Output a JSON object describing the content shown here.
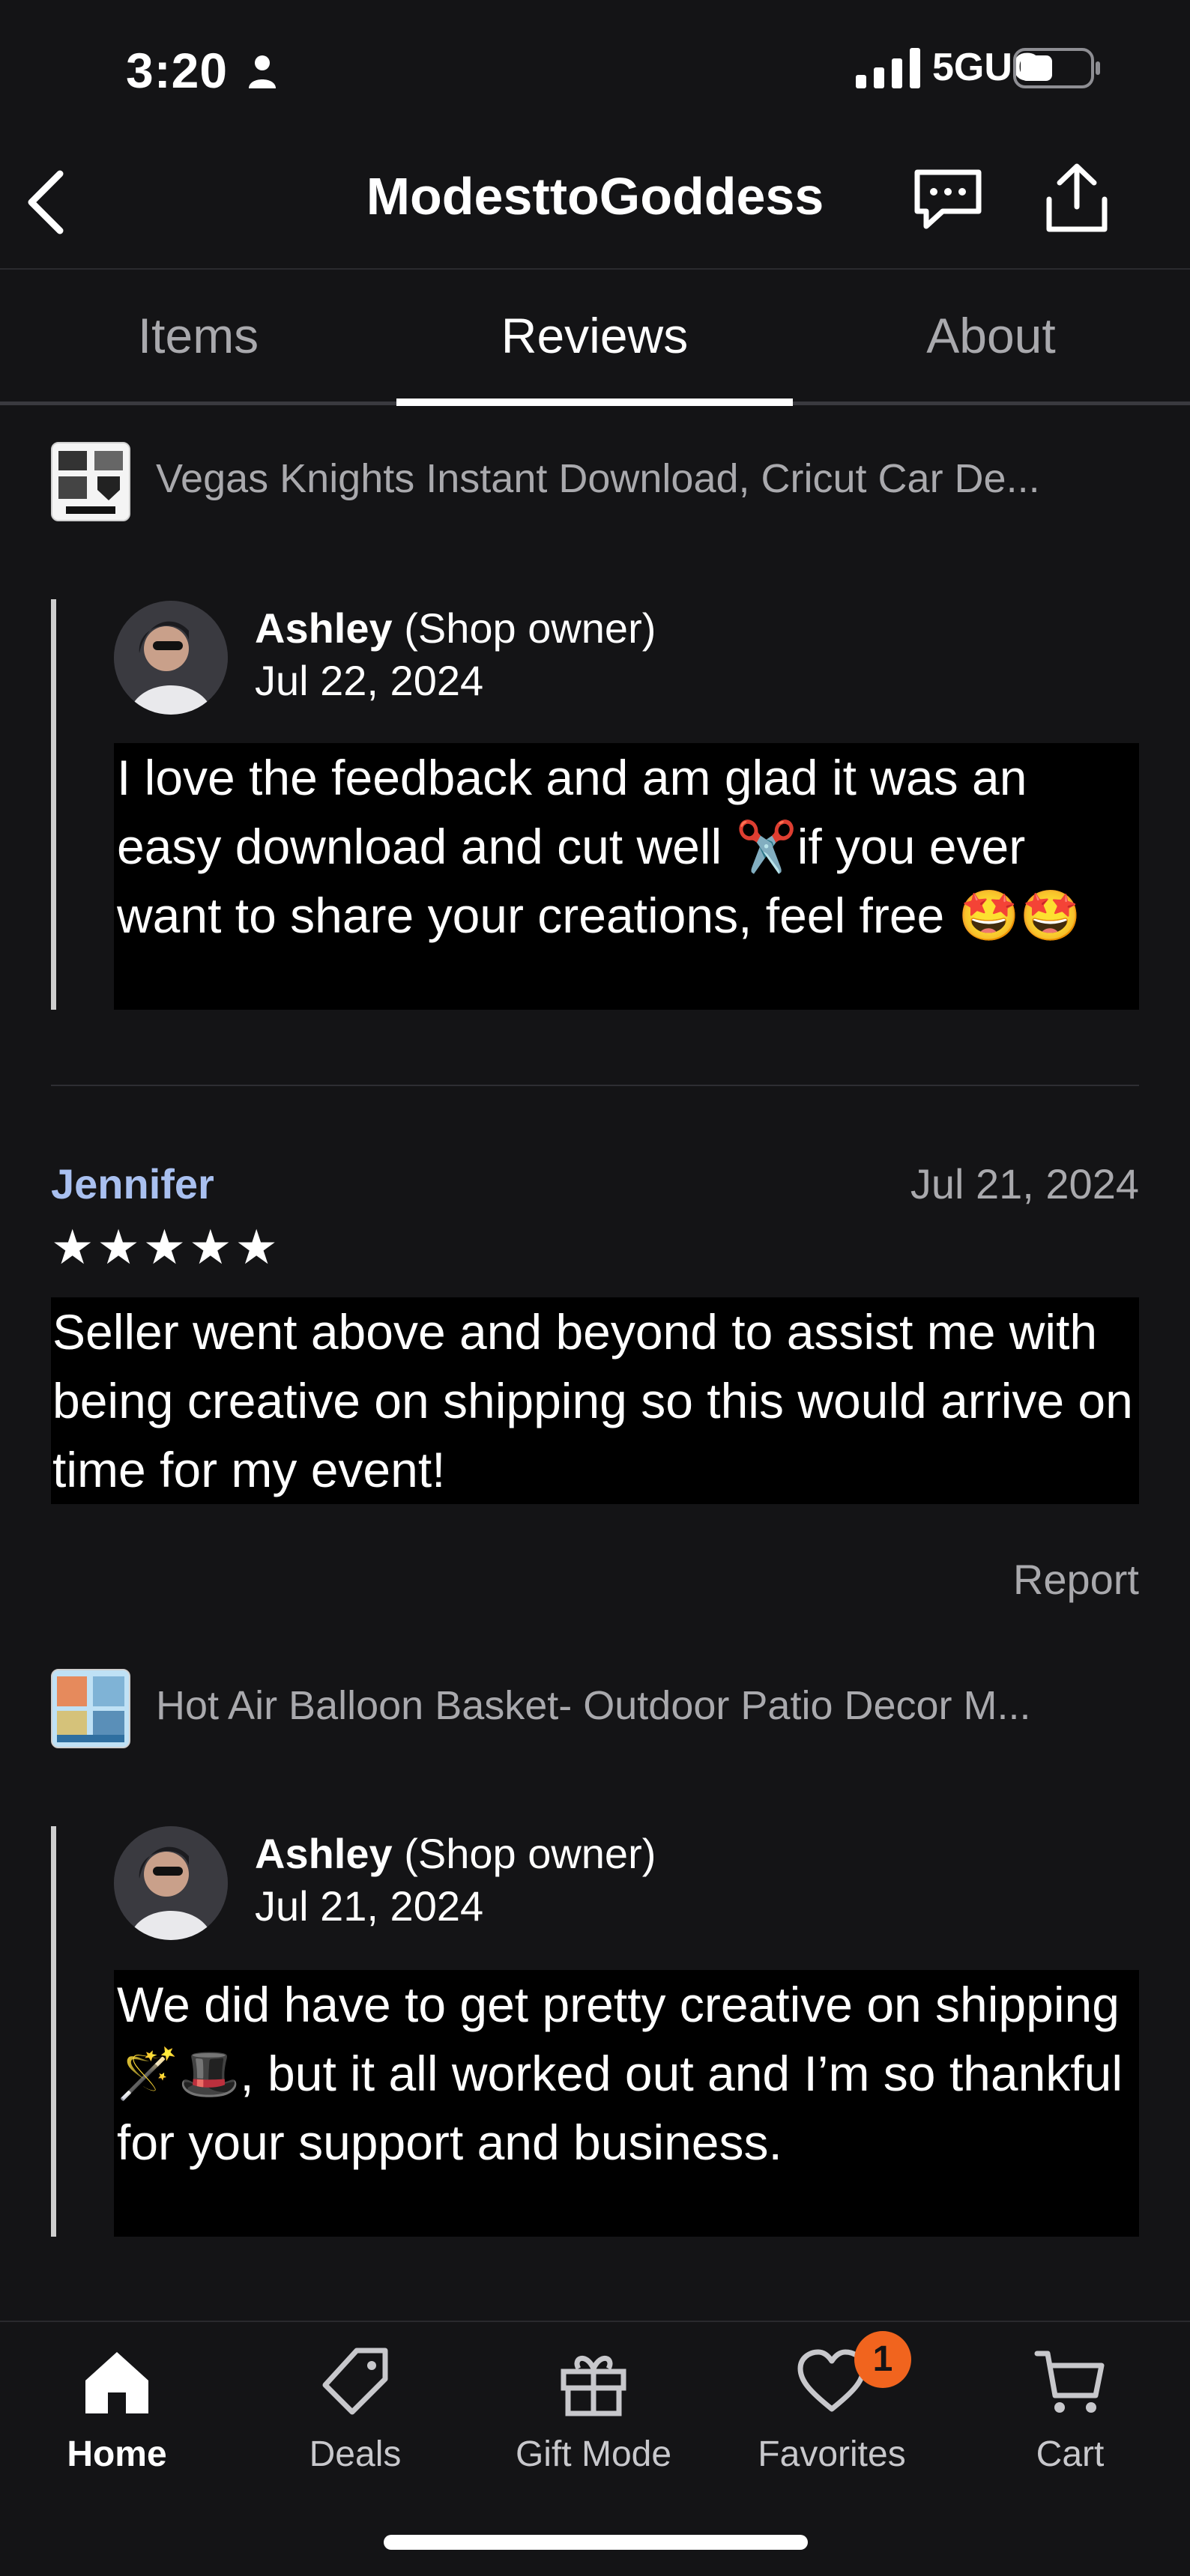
{
  "status_bar": {
    "time": "3:20",
    "network": "5GUC"
  },
  "header": {
    "title": "ModesttoGoddess"
  },
  "tabs": [
    {
      "label": "Items",
      "active": false
    },
    {
      "label": "Reviews",
      "active": true
    },
    {
      "label": "About",
      "active": false
    }
  ],
  "listing1": {
    "title": "Vegas Knights Instant Download, Cricut Car De..."
  },
  "reply1": {
    "name": "Ashley",
    "role": "(Shop owner)",
    "date": "Jul 22, 2024",
    "text": "I love the feedback and am glad it was an easy download and cut well ✂️if you ever want to share your creations, feel free 🤩🤩"
  },
  "review": {
    "reviewer": "Jennifer",
    "date": "Jul 21, 2024",
    "rating": 5,
    "stars": "★★★★★",
    "text": "Seller went above and beyond to assist me with being creative on shipping so this would arrive on time for my event!",
    "report_label": "Report"
  },
  "listing2": {
    "title": "Hot Air Balloon Basket- Outdoor Patio Decor M..."
  },
  "reply2": {
    "name": "Ashley",
    "role": "(Shop owner)",
    "date": "Jul 21, 2024",
    "text": "We did have to get pretty creative on shipping 🪄🎩, but it all worked out and I’m so thankful for your support and business."
  },
  "bottom_nav": {
    "items": [
      {
        "label": "Home",
        "icon": "home-icon",
        "active": true
      },
      {
        "label": "Deals",
        "icon": "tag-icon",
        "active": false
      },
      {
        "label": "Gift Mode",
        "icon": "gift-icon",
        "active": false
      },
      {
        "label": "Favorites",
        "icon": "heart-icon",
        "active": false
      },
      {
        "label": "Cart",
        "icon": "cart-icon",
        "active": false
      }
    ],
    "favorites_badge": "1"
  },
  "colors": {
    "background": "#141416",
    "reviewer_name": "#a9c0f0",
    "badge": "#f1641e",
    "muted_text": "#a9a9ad"
  }
}
